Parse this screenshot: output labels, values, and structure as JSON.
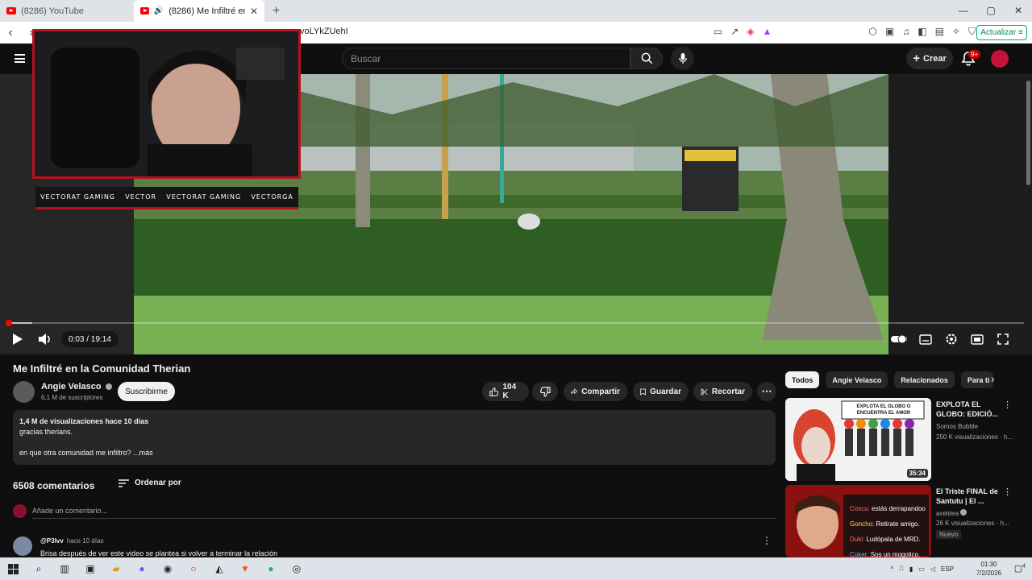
{
  "browser": {
    "tabs": [
      {
        "title": "(8286) YouTube",
        "active": false
      },
      {
        "title": "(8286) Me Infiltré en la Comun",
        "active": true
      }
    ],
    "url": "voLYkZUehI",
    "update_label": "Actualizar",
    "window_controls": [
      "—",
      "▢",
      "✕"
    ]
  },
  "header": {
    "search_placeholder": "Buscar",
    "create_label": "Crear",
    "notif_count": "9+"
  },
  "player": {
    "time": "0:03 / 19:14",
    "progress": 0.003,
    "overlay_socials": [
      "VECTORAT GAMING",
      "VECTOR",
      "VECTORAT GAMING",
      "VECTORGA"
    ]
  },
  "video": {
    "title": "Me Infiltré en la Comunidad Therian",
    "channel": "Angie Velasco",
    "subscribers": "6,1 M de suscriptores",
    "subscribe_label": "Suscribirme",
    "likes": "104 K",
    "share_label": "Compartir",
    "save_label": "Guardar",
    "clip_label": "Recortar",
    "views_line": "1,4 M de visualizaciones  hace 10 días",
    "desc_line1": "gracias therians.",
    "desc_line2": "en que otra comunidad me infiltro? ...más"
  },
  "comments": {
    "count": "6508 comentarios",
    "sort_label": "Ordenar por",
    "add_placeholder": "Añade un comentario...",
    "items": [
      {
        "author": "@P3lvv",
        "time": "hace 10 días",
        "text": "Brisa después de ver este video se plantea si volver a terminar la relación"
      }
    ]
  },
  "sidebar": {
    "chips": [
      "Todos",
      "Angie Velasco",
      "Relacionados",
      "Para ti"
    ],
    "videos": [
      {
        "title": "EXPLOTA EL GLOBO: EDICIÓ...",
        "channel": "Somos Bubble",
        "meta": "250 K visualizaciones · h...",
        "duration": "35:34",
        "thumb_caption": "EXPLOTA EL GLOBO O ENCUENTRA EL AMOR"
      },
      {
        "title": "El Triste FINAL de Santutu | El ...",
        "channel": "axeldea",
        "meta": "26 K visualizaciones · h...",
        "badge": "Nuevo",
        "chat": [
          {
            "name": "Coscu:",
            "msg": "estás derrapandoo"
          },
          {
            "name": "Goncho:",
            "msg": "Retirate amigo."
          },
          {
            "name": "Duki:",
            "msg": "Ludópata de MRD."
          },
          {
            "name": "Coker:",
            "msg": "Sos un mogolico."
          }
        ]
      }
    ]
  },
  "taskbar": {
    "lang": "ESP",
    "time": "01:30",
    "date": "7/2/2026",
    "notif_count": "4"
  }
}
